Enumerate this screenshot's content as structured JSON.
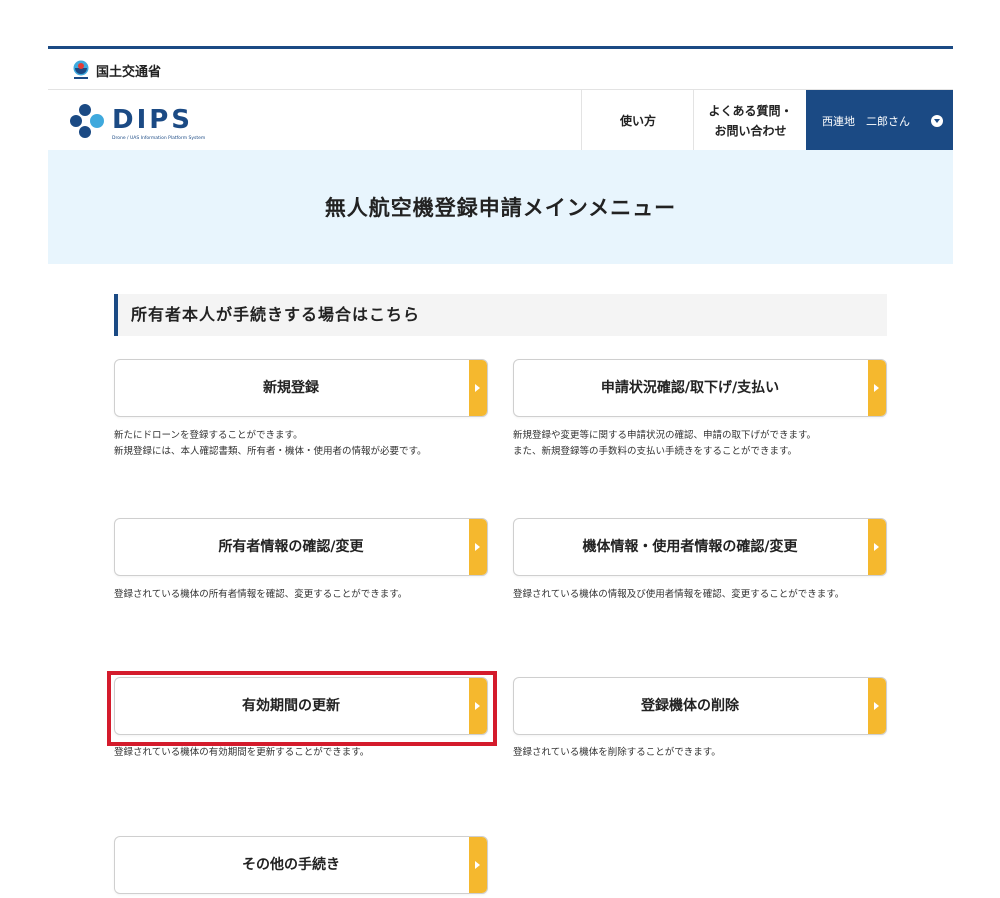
{
  "ministry": {
    "name": "国土交通省",
    "icon": "mlit-logo-icon"
  },
  "logo": {
    "text": "DIPS",
    "subtitle": "Drone / UAS Information Platform System"
  },
  "nav": {
    "how_to": "使い方",
    "faq_line1": "よくある質問・",
    "faq_line2": "お問い合わせ",
    "user_name": "西連地　二郎さん",
    "user_menu_icon": "chevron-down-circle-icon"
  },
  "page_title": "無人航空機登録申請メインメニュー",
  "section_title": "所有者本人が手続きする場合はこちら",
  "menu": [
    {
      "label": "新規登録",
      "desc1": "新たにドローンを登録することができます。",
      "desc2": "新規登録には、本人確認書類、所有者・機体・使用者の情報が必要です。"
    },
    {
      "label": "申請状況確認/取下げ/支払い",
      "desc1": "新規登録や変更等に関する申請状況の確認、申請の取下げができます。",
      "desc2": "また、新規登録等の手数料の支払い手続きをすることができます。"
    },
    {
      "label": "所有者情報の確認/変更",
      "desc1": "登録されている機体の所有者情報を確認、変更することができます。"
    },
    {
      "label": "機体情報・使用者情報の確認/変更",
      "desc1": "登録されている機体の情報及び使用者情報を確認、変更することができます。"
    },
    {
      "label": "有効期間の更新",
      "desc1": "登録されている機体の有効期間を更新することができます。"
    },
    {
      "label": "登録機体の削除",
      "desc1": "登録されている機体を削除することができます。"
    },
    {
      "label": "その他の手続き"
    }
  ],
  "colors": {
    "brand": "#1b4a84",
    "accent": "#f5b82e",
    "hero_bg": "#e8f5fd",
    "highlight": "#d41b2c"
  }
}
